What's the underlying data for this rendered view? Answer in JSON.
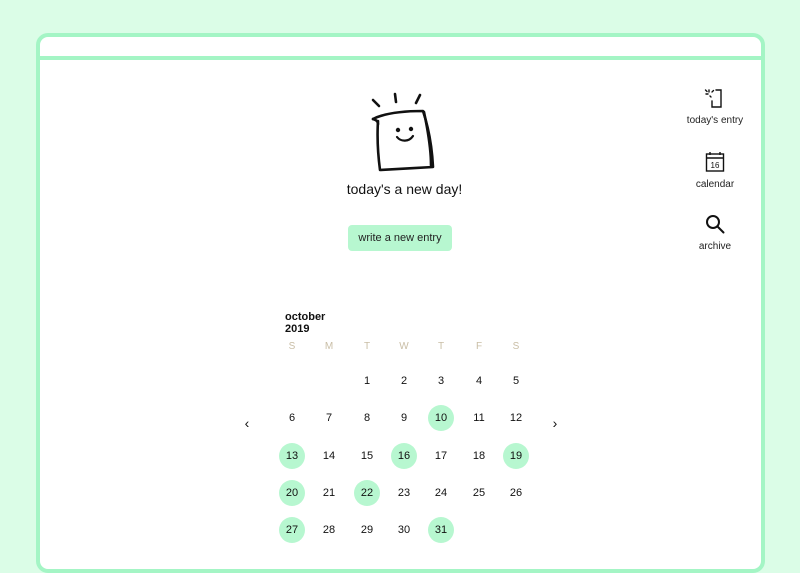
{
  "hero": {
    "tagline": "today's a new day!",
    "write_button": "write a new entry",
    "mascot_icon": "smiling-notepad-doodle"
  },
  "nav": {
    "items": [
      {
        "label": "today's entry",
        "icon": "new-page-icon"
      },
      {
        "label": "calendar",
        "icon": "calendar-icon",
        "icon_text": "16"
      },
      {
        "label": "archive",
        "icon": "search-icon"
      }
    ]
  },
  "calendar": {
    "month": "october 2019",
    "weekdays": [
      "S",
      "M",
      "T",
      "W",
      "T",
      "F",
      "S"
    ],
    "prev_arrow": "‹",
    "next_arrow": "›",
    "first_weekday_index": 2,
    "days": [
      "1",
      "2",
      "3",
      "4",
      "5",
      "6",
      "7",
      "8",
      "9",
      "10",
      "11",
      "12",
      "13",
      "14",
      "15",
      "16",
      "17",
      "18",
      "19",
      "20",
      "21",
      "22",
      "23",
      "24",
      "25",
      "26",
      "27",
      "28",
      "29",
      "30",
      "31"
    ],
    "marked_days": [
      10,
      13,
      16,
      19,
      20,
      22,
      27,
      31
    ]
  },
  "colors": {
    "background": "#dbfde7",
    "accent": "#a4f5c5",
    "highlight": "#b7f7d0",
    "weekday_text": "#c9bea6"
  }
}
